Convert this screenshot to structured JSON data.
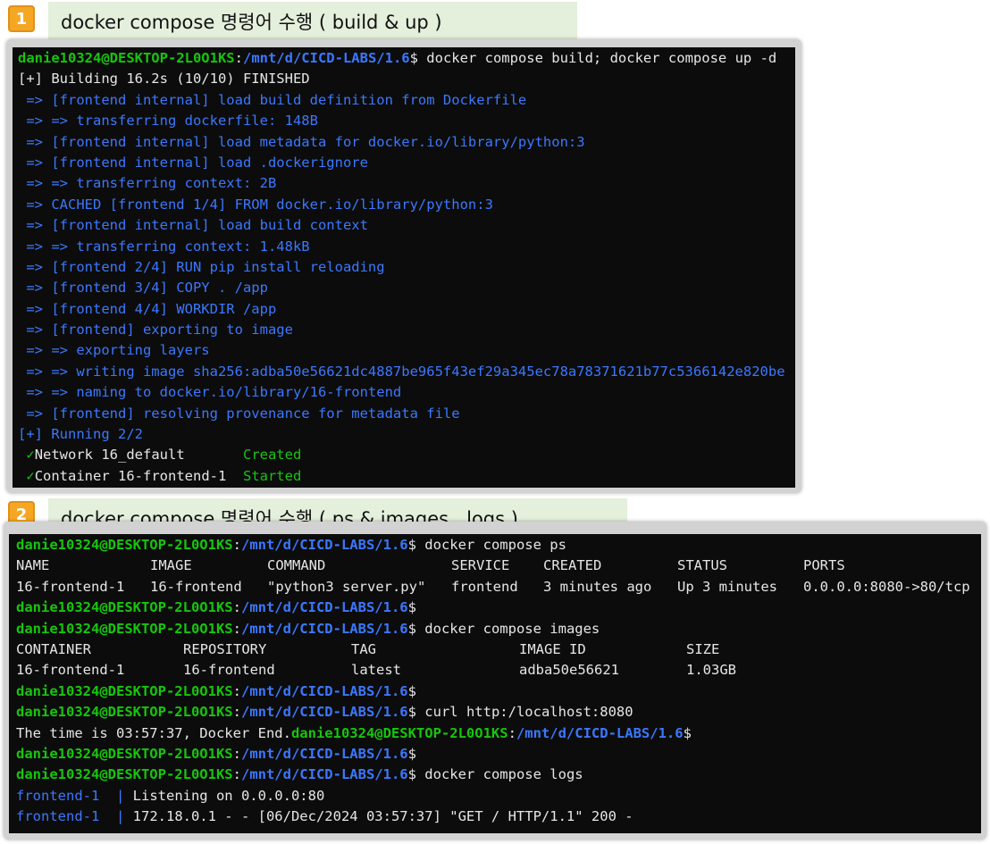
{
  "section1": {
    "badge": "1",
    "caption": "docker compose 명령어 수행 ( build & up )"
  },
  "section2": {
    "badge": "2",
    "caption": "docker compose 명령어 수행 ( ps & images , logs )"
  },
  "prompt": {
    "user": "danie10324@DESKTOP-2L0O1KS",
    "sep": ":",
    "path": "/mnt/d/CICD-LABS/1.6",
    "dollar": "$"
  },
  "term1": {
    "command": " docker compose build; docker compose up -d",
    "building": "[+] Building 16.2s (10/10) FINISHED",
    "build_steps": [
      " => [frontend internal] load build definition from Dockerfile",
      " => => transferring dockerfile: 148B",
      " => [frontend internal] load metadata for docker.io/library/python:3",
      " => [frontend internal] load .dockerignore",
      " => => transferring context: 2B",
      " => CACHED [frontend 1/4] FROM docker.io/library/python:3",
      " => [frontend internal] load build context",
      " => => transferring context: 1.48kB",
      " => [frontend 2/4] RUN pip install reloading",
      " => [frontend 3/4] COPY . /app",
      " => [frontend 4/4] WORKDIR /app",
      " => [frontend] exporting to image",
      " => => exporting layers",
      " => => writing image sha256:adba50e56621dc4887be965f43ef29a345ec78a78371621b77c5366142e820be",
      " => => naming to docker.io/library/16-frontend",
      " => [frontend] resolving provenance for metadata file"
    ],
    "running": "[+] Running 2/2",
    "results": [
      {
        "check": "✓",
        "label": "Network 16_default       ",
        "status": "Created"
      },
      {
        "check": "✓",
        "label": "Container 16-frontend-1  ",
        "status": "Started"
      }
    ]
  },
  "term2": {
    "cmd_ps": " docker compose ps",
    "ps_headers": [
      "NAME",
      "IMAGE",
      "COMMAND",
      "SERVICE",
      "CREATED",
      "STATUS",
      "PORTS"
    ],
    "ps_row": [
      "16-frontend-1",
      "16-frontend",
      "\"python3 server.py\"",
      "frontend",
      "3 minutes ago",
      "Up 3 minutes",
      "0.0.0.0:8080->80/tcp"
    ],
    "cmd_images": " docker compose images",
    "img_headers": [
      "CONTAINER",
      "REPOSITORY",
      "TAG",
      "IMAGE ID",
      "SIZE"
    ],
    "img_row": [
      "16-frontend-1",
      "16-frontend",
      "latest",
      "adba50e56621",
      "1.03GB"
    ],
    "cmd_curl": " curl http:/localhost:8080",
    "curl_output": "The time is 03:57:37, Docker End.",
    "cmd_logs": " docker compose logs",
    "logs": [
      {
        "service": "frontend-1",
        "bar": "  | ",
        "message": "Listening on 0.0.0.0:80"
      },
      {
        "service": "frontend-1",
        "bar": "  | ",
        "message": "172.18.0.1 - - [06/Dec/2024 03:57:37] \"GET / HTTP/1.1\" 200 -"
      }
    ]
  },
  "colors": {
    "prompt_user": "#16c60c",
    "prompt_path": "#3b78ff",
    "badge": "#f5a623",
    "caption_bg": "#e4efdc"
  }
}
